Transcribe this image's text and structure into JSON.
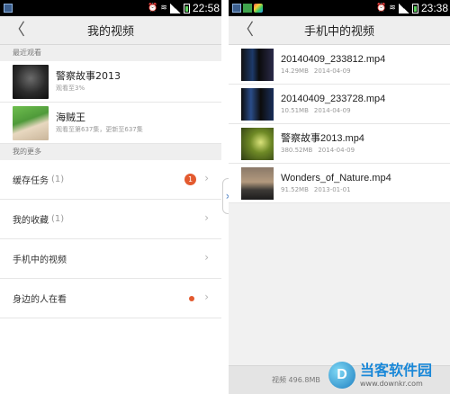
{
  "left_screen": {
    "status_time": "22:58",
    "title": "我的视频",
    "recent_header": "最近观看",
    "recent": [
      {
        "title": "警察故事2013",
        "sub": "观看至3%"
      },
      {
        "title": "海贼王",
        "sub": "观看至第637集，更新至637集"
      }
    ],
    "more_header": "我的更多",
    "menu": [
      {
        "label": "缓存任务",
        "count": "(1)",
        "badge": "1"
      },
      {
        "label": "我的收藏",
        "count": "(1)"
      },
      {
        "label": "手机中的视频",
        "count": ""
      },
      {
        "label": "身边的人在看",
        "count": ""
      }
    ]
  },
  "right_screen": {
    "status_time": "23:38",
    "title": "手机中的视频",
    "files": [
      {
        "name": "20140409_233812.mp4",
        "size": "14.29MB",
        "date": "2014-04-09"
      },
      {
        "name": "20140409_233728.mp4",
        "size": "10.51MB",
        "date": "2014-04-09"
      },
      {
        "name": "警察故事2013.mp4",
        "size": "380.52MB",
        "date": "2014-04-09"
      },
      {
        "name": "Wonders_of_Nature.mp4",
        "size": "91.52MB",
        "date": "2013-01-01"
      }
    ],
    "footer": "视频 496.8MB"
  },
  "watermark": {
    "name": "当客软件园",
    "url": "www.downkr.com"
  },
  "colors": {
    "badge": "#e35a2f",
    "titlebar": "#eeeeee",
    "accent_blue": "#4a7fc4"
  }
}
